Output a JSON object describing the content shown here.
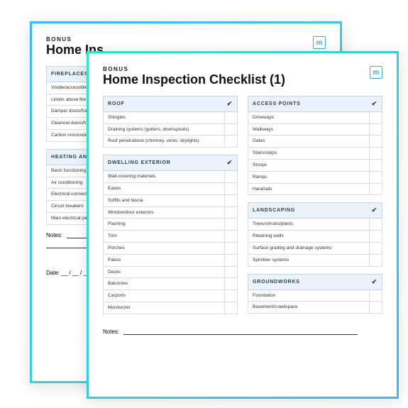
{
  "logo_letter": "m",
  "back": {
    "eyebrow": "BONUS",
    "title": "Home Ins",
    "sections": [
      {
        "title": "FIREPLACES AND CHIMN",
        "items": [
          "Visible/accessible portions",
          "Lintels above the fireplace o",
          "Damper doors/frames",
          "Cleanout doors/frames",
          "Carbon monoxide detector"
        ]
      },
      {
        "title": "HEATING AND COOLING SYSTEMS + OTHER UTIL",
        "items": [
          "Basic functioning of furnace/ pumps",
          "Air conditioning",
          "Electrical connections",
          "Circuit breakers",
          "Main electrical panel"
        ]
      }
    ],
    "notes_label": "Notes:",
    "date_label": "Date: __ / __ / __    A"
  },
  "front": {
    "eyebrow": "BONUS",
    "title": "Home Inspection Checklist (1)",
    "left_sections": [
      {
        "title": "ROOF",
        "items": [
          "Shingles",
          "Draining systems (gutters, downspouts)",
          "Roof penetrations (chimney, vents, skylights)"
        ]
      },
      {
        "title": "DWELLING EXTERIOR",
        "items": [
          "Wall-covering materials",
          "Eaves",
          "Soffits and fascia",
          "Window/door exteriors",
          "Flashing",
          "Trim",
          "Porches",
          "Patios",
          "Decks",
          "Balconies",
          "Carports",
          "Moisturizer"
        ]
      }
    ],
    "right_sections": [
      {
        "title": "ACCESS POINTS",
        "items": [
          "Driveways",
          "Walkways",
          "Gates",
          "Stairs/steps",
          "Stoops",
          "Ramps",
          "Handrails"
        ]
      },
      {
        "title": "LANDSCAPING",
        "items": [
          "Trees/shrubs/plants",
          "Retaining walls",
          "Surface grading and drainage systems",
          "Sprinkler systems"
        ]
      },
      {
        "title": "GROUNDWORKS",
        "items": [
          "Foundation",
          "Basement/crawlspace"
        ]
      }
    ],
    "notes_label": "Notes:"
  }
}
